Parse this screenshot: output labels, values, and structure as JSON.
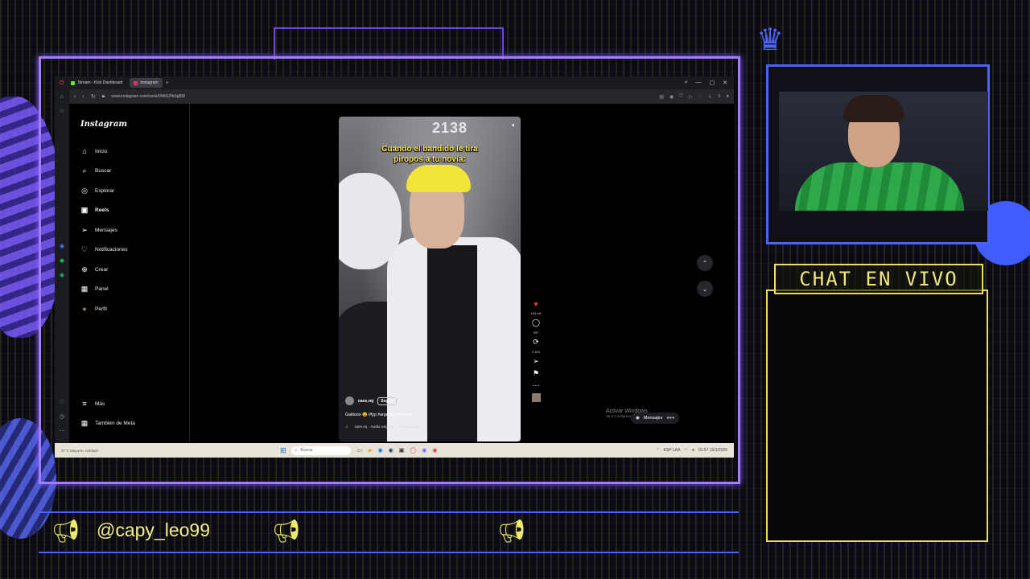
{
  "browser": {
    "tabs": [
      {
        "label": "Stream - Kick Dashboard",
        "color": "#53fc18"
      },
      {
        "label": "Instagram",
        "color": "#e1306c"
      }
    ],
    "new_tab": "+",
    "url": "www.instagram.com/reels/DMtU2fbSgB8/"
  },
  "instagram": {
    "logo": "Instagram",
    "nav": [
      {
        "label": "Inicio",
        "icon": "home-icon",
        "glyph": "⌂"
      },
      {
        "label": "Buscar",
        "icon": "search-icon",
        "glyph": "⌕"
      },
      {
        "label": "Explorar",
        "icon": "compass-icon",
        "glyph": "◎"
      },
      {
        "label": "Reels",
        "icon": "reels-icon",
        "glyph": "▣"
      },
      {
        "label": "Mensajes",
        "icon": "send-icon",
        "glyph": "➢"
      },
      {
        "label": "Notificaciones",
        "icon": "heart-icon",
        "glyph": "♡"
      },
      {
        "label": "Crear",
        "icon": "plus-icon",
        "glyph": "⊕"
      },
      {
        "label": "Panel",
        "icon": "dashboard-icon",
        "glyph": "▦"
      },
      {
        "label": "Perfil",
        "icon": "avatar-icon",
        "glyph": "●"
      }
    ],
    "more": "Más",
    "meta": "También de Meta"
  },
  "reel": {
    "overlay_number": "2138",
    "caption_line1": "Cuando el bandido le tira",
    "caption_line2": "piropos a tu novia:",
    "username": "raes.mj",
    "follow": "Seguir",
    "description": "Gatitooo 😵 #fyp #argentina #humor",
    "audio": "raes.mj · Audio original",
    "people": "2 personas",
    "likes": "163 mil",
    "comments": "357",
    "reposts": "2.404"
  },
  "overlay": {
    "activate_title": "Activar Windows",
    "activate_sub": "Ve a Configuración para activar Windows.",
    "messages": "Mensajes"
  },
  "taskbar": {
    "weather": "37°C Mayorm. nublado",
    "search": "Buscar",
    "lang": "ESP LAA",
    "clock": "01:57 15/1/2026"
  },
  "stream": {
    "chat_title": "CHAT EN VIVO",
    "handle": "@capy_leo99"
  },
  "colors": {
    "accent_purple": "#a77bff",
    "accent_blue": "#4b63ff",
    "accent_yellow": "#e8e060"
  }
}
